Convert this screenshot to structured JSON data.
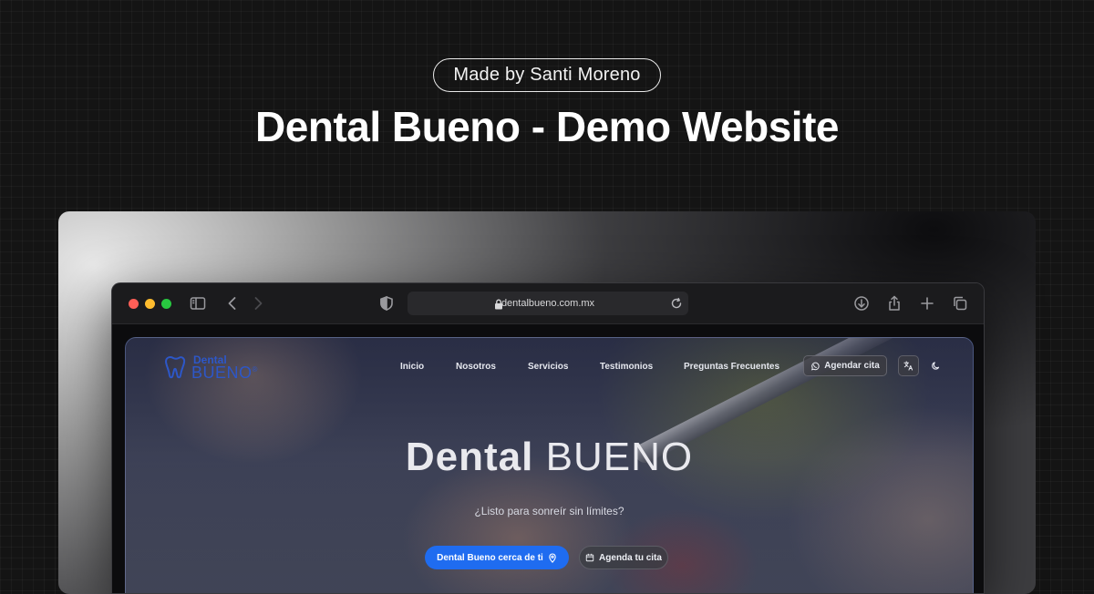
{
  "header": {
    "credit": "Made by Santi Moreno",
    "title": "Dental Bueno - Demo Website"
  },
  "browser": {
    "url": "dentalbueno.com.mx",
    "toolbar_icons": [
      "sidebar-icon",
      "back-icon",
      "forward-icon",
      "shield-icon",
      "lock-icon",
      "reload-icon",
      "download-icon",
      "share-icon",
      "plus-icon",
      "tabs-icon"
    ]
  },
  "site": {
    "logo": {
      "line1": "Dental",
      "line2": "BUENO",
      "mark": "®"
    },
    "nav": [
      "Inicio",
      "Nosotros",
      "Servicios",
      "Testimonios",
      "Preguntas Frecuentes"
    ],
    "agendar_label": "Agendar cita",
    "hero": {
      "title_bold": "Dental",
      "title_light": "BUENO",
      "subtitle": "¿Listo para sonreír sin límites?",
      "cta_primary": "Dental Bueno cerca de ti",
      "cta_secondary": "Agenda tu cita"
    },
    "colors": {
      "accent": "#1f6cf0",
      "logo": "#2d57c8"
    }
  }
}
